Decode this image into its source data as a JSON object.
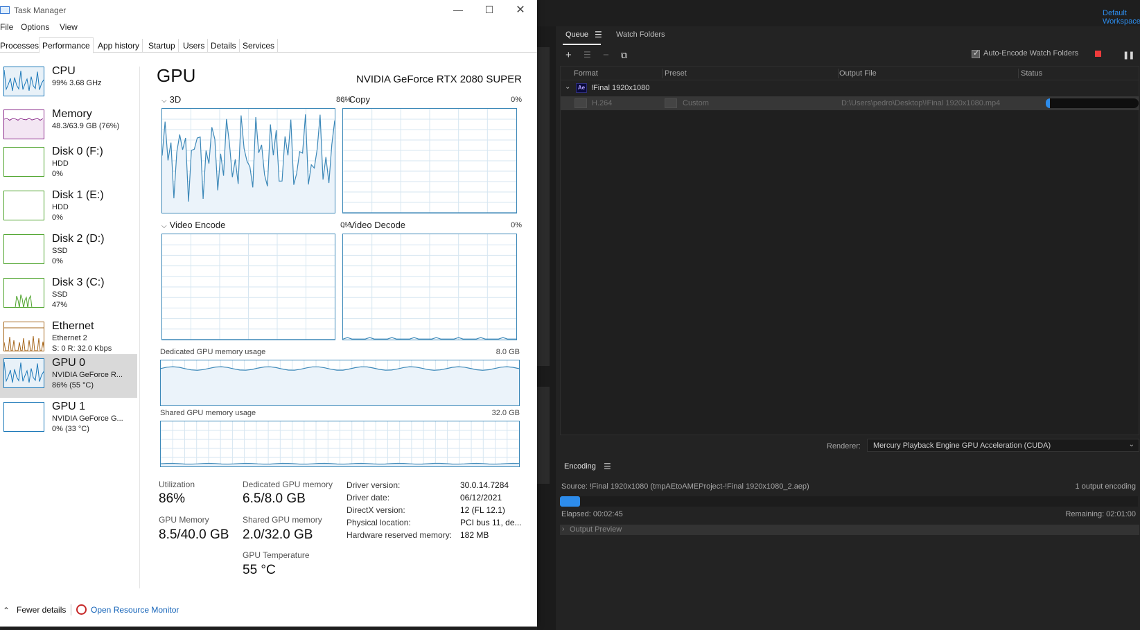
{
  "ame": {
    "workspace": "Default Workspace",
    "tabs": [
      "Queue",
      "Watch Folders"
    ],
    "toolbar": {
      "add_icon": "plus-icon",
      "settings_icon": "sliders-icon",
      "remove_icon": "minus-icon",
      "duplicate_icon": "duplicate-icon",
      "auto_encode_label": "Auto-Encode Watch Folders",
      "auto_encode_checked": true,
      "stop_color": "#ef3b3b"
    },
    "columns": [
      "Format",
      "Preset",
      "Output File",
      "Status"
    ],
    "group": {
      "badge": "Ae",
      "name": "!Final 1920x1080"
    },
    "row": {
      "format": "H.264",
      "preset": "Custom",
      "output_file": "D:\\Users\\pedro\\Desktop\\!Final 1920x1080.mp4",
      "progress": 0.03
    },
    "renderer_label": "Renderer:",
    "renderer_value": "Mercury Playback Engine GPU Acceleration (CUDA)",
    "encoding": {
      "tab": "Encoding",
      "source": "Source: !Final 1920x1080 (tmpAEtoAMEProject-!Final 1920x1080_2.aep)",
      "count": "1 output encoding",
      "progress": 0.035,
      "elapsed": "Elapsed: 00:02:45",
      "remaining": "Remaining: 02:01:00",
      "output_preview": "Output Preview"
    },
    "accent": "#2d8ceb"
  },
  "tm": {
    "title": "Task Manager",
    "menu": [
      "File",
      "Options",
      "View"
    ],
    "tabs": [
      "Processes",
      "Performance",
      "App history",
      "Startup",
      "Users",
      "Details",
      "Services"
    ],
    "active_tab": "Performance",
    "sidebar": [
      {
        "name": "CPU",
        "sub1": "99%  3.68 GHz",
        "sub2": "",
        "sub3": "",
        "color": "#1a77b8"
      },
      {
        "name": "Memory",
        "sub1": "48.3/63.9 GB (76%)",
        "sub2": "",
        "sub3": "",
        "color": "#8b2b8b"
      },
      {
        "name": "Disk 0 (F:)",
        "sub1": "HDD",
        "sub2": "0%",
        "sub3": "",
        "color": "#4da32b"
      },
      {
        "name": "Disk 1 (E:)",
        "sub1": "HDD",
        "sub2": "0%",
        "sub3": "",
        "color": "#4da32b"
      },
      {
        "name": "Disk 2 (D:)",
        "sub1": "SSD",
        "sub2": "0%",
        "sub3": "",
        "color": "#4da32b"
      },
      {
        "name": "Disk 3 (C:)",
        "sub1": "SSD",
        "sub2": "47%",
        "sub3": "",
        "color": "#4da32b"
      },
      {
        "name": "Ethernet",
        "sub1": "Ethernet 2",
        "sub2": "S: 0  R: 32.0 Kbps",
        "sub3": "",
        "color": "#a5651a"
      },
      {
        "name": "GPU 0",
        "sub1": "NVIDIA GeForce R...",
        "sub2": "86%  (55 °C)",
        "sub3": "",
        "color": "#1a77b8"
      },
      {
        "name": "GPU 1",
        "sub1": "NVIDIA GeForce G...",
        "sub2": "0%  (33 °C)",
        "sub3": "",
        "color": "#1a77b8"
      }
    ],
    "gpu": {
      "title": "GPU",
      "model": "NVIDIA GeForce RTX 2080 SUPER",
      "engines": [
        {
          "label": "3D",
          "pct": "86%"
        },
        {
          "label": "Copy",
          "pct": "0%"
        },
        {
          "label": "Video Encode",
          "pct": "0%"
        },
        {
          "label": "Video Decode",
          "pct": "0%"
        }
      ],
      "dedicated_label": "Dedicated GPU memory usage",
      "dedicated_max": "8.0 GB",
      "shared_label": "Shared GPU memory usage",
      "shared_max": "32.0 GB",
      "graph_color": "#3c88b8",
      "stats": {
        "utilization_label": "Utilization",
        "utilization": "86%",
        "dedicated_mem_label": "Dedicated GPU memory",
        "dedicated_mem": "6.5/8.0 GB",
        "gpu_mem_label": "GPU Memory",
        "gpu_mem": "8.5/40.0 GB",
        "shared_mem_label": "Shared GPU memory",
        "shared_mem": "2.0/32.0 GB",
        "temp_label": "GPU Temperature",
        "temp": "55 °C"
      },
      "info": [
        {
          "label": "Driver version:",
          "value": "30.0.14.7284"
        },
        {
          "label": "Driver date:",
          "value": "06/12/2021"
        },
        {
          "label": "DirectX version:",
          "value": "12 (FL 12.1)"
        },
        {
          "label": "Physical location:",
          "value": "PCI bus 11, de..."
        },
        {
          "label": "Hardware reserved memory:",
          "value": "182 MB"
        }
      ]
    },
    "footer": {
      "fewer": "Fewer details",
      "monitor": "Open Resource Monitor"
    }
  }
}
